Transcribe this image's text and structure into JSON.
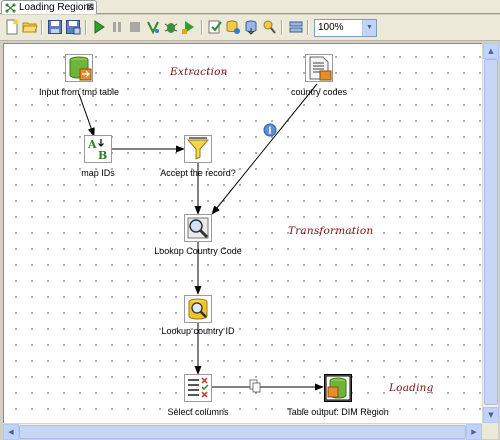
{
  "tab": {
    "title": "Loading Regions",
    "close_glyph": "⊠"
  },
  "toolbar": {
    "zoom_value": "100%",
    "buttons": [
      "new-file-icon",
      "open-file-icon",
      "save-icon",
      "save-as-icon",
      "run-icon",
      "pause-icon",
      "stop-icon",
      "preview-icon",
      "debug-icon",
      "replay-icon",
      "verify-icon",
      "impact-icon",
      "sql-icon",
      "explore-db-icon",
      "align-icon"
    ]
  },
  "canvas": {
    "steps": [
      {
        "id": "input",
        "label": "Input from tmp table",
        "icon": "table-input-icon"
      },
      {
        "id": "country_codes",
        "label": "country codes",
        "icon": "text-file-input-icon"
      },
      {
        "id": "map_ids",
        "label": "map IDs",
        "icon": "value-mapper-icon"
      },
      {
        "id": "accept",
        "label": "Accept the record?",
        "icon": "filter-rows-icon"
      },
      {
        "id": "lookup_code",
        "label": "Lookup Country Code",
        "icon": "stream-lookup-icon"
      },
      {
        "id": "lookup_id",
        "label": "Lookup country ID",
        "icon": "database-lookup-icon"
      },
      {
        "id": "select",
        "label": "Select columns",
        "icon": "select-values-icon"
      },
      {
        "id": "output",
        "label": "Table output: DIM Region",
        "icon": "table-output-icon"
      }
    ],
    "notes": {
      "extraction": "Extraction",
      "transformation": "Transformation",
      "loading": "Loading"
    },
    "hop_info_glyph": "i"
  }
}
